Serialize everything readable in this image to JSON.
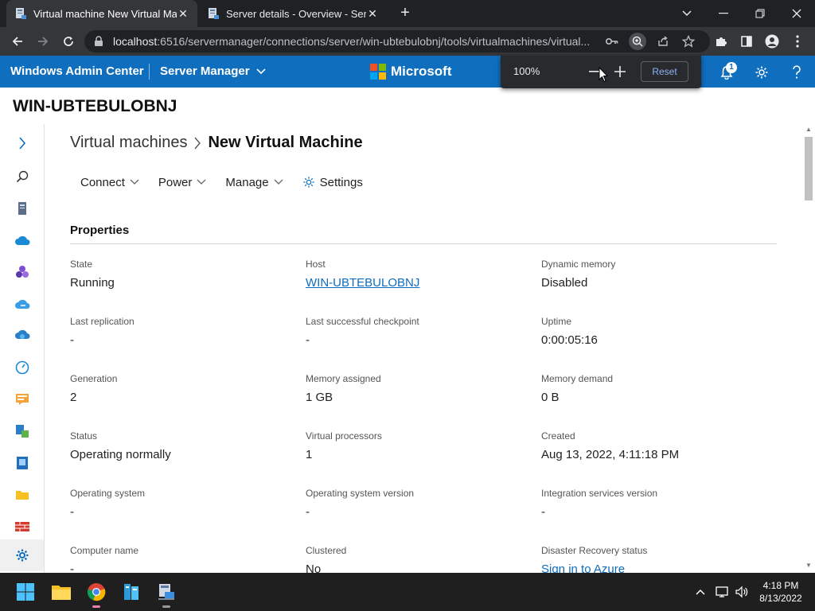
{
  "browser": {
    "tabs": [
      {
        "title": "Virtual machine New Virtual Mac",
        "active": true
      },
      {
        "title": "Server details - Overview - Server",
        "active": false
      }
    ],
    "url_host": "localhost",
    "url_rest": ":6516/servermanager/connections/server/win-ubtebulobnj/tools/virtualmachines/virtual..."
  },
  "zoom_popup": {
    "percent": "100%",
    "reset_label": "Reset"
  },
  "app": {
    "brand": "Windows Admin Center",
    "tool": "Server Manager",
    "vendor": "Microsoft",
    "notification_count": "1"
  },
  "server_name": "WIN-UBTEBULOBNJ",
  "breadcrumb": {
    "parent": "Virtual machines",
    "current": "New Virtual Machine"
  },
  "toolbar": {
    "connect": "Connect",
    "power": "Power",
    "manage": "Manage",
    "settings": "Settings"
  },
  "section_title": "Properties",
  "properties": [
    {
      "label": "State",
      "value": "Running"
    },
    {
      "label": "Host",
      "value": "WIN-UBTEBULOBNJ",
      "link": true
    },
    {
      "label": "Dynamic memory",
      "value": "Disabled"
    },
    {
      "label": "Last replication",
      "value": "-"
    },
    {
      "label": "Last successful checkpoint",
      "value": "-"
    },
    {
      "label": "Uptime",
      "value": "0:00:05:16"
    },
    {
      "label": "Generation",
      "value": "2"
    },
    {
      "label": "Memory assigned",
      "value": "1 GB"
    },
    {
      "label": "Memory demand",
      "value": "0 B"
    },
    {
      "label": "Status",
      "value": "Operating normally"
    },
    {
      "label": "Virtual processors",
      "value": "1"
    },
    {
      "label": "Created",
      "value": "Aug 13, 2022, 4:11:18 PM"
    },
    {
      "label": "Operating system",
      "value": "-"
    },
    {
      "label": "Operating system version",
      "value": "-"
    },
    {
      "label": "Integration services version",
      "value": "-"
    },
    {
      "label": "Computer name",
      "value": "-"
    },
    {
      "label": "Clustered",
      "value": "No"
    },
    {
      "label": "Disaster Recovery status",
      "value": "Sign in to Azure",
      "link": true
    }
  ],
  "clock": {
    "time": "4:18 PM",
    "date": "8/13/2022"
  },
  "colors": {
    "accent": "#106ebe",
    "link": "#0f6cbd"
  }
}
